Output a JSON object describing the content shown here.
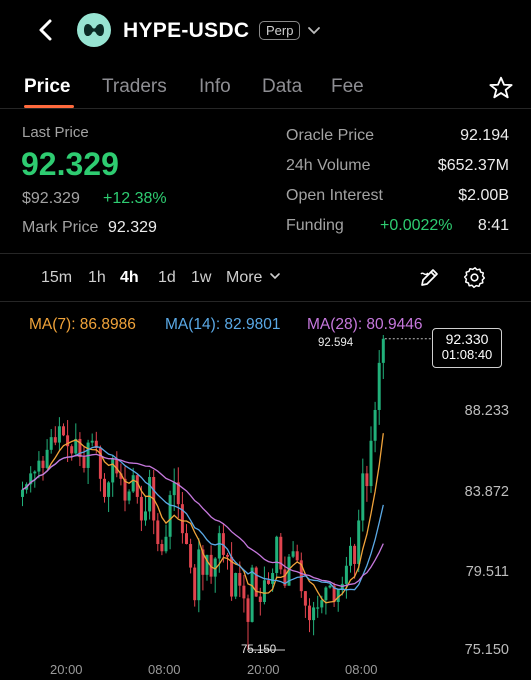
{
  "header": {
    "back_icon": "chevron-left-icon",
    "logo_icon": "hyperliquid-logo-icon",
    "title": "HYPE-USDC",
    "badge": "Perp",
    "dropdown_icon": "chevron-down-icon"
  },
  "tabs": [
    "Price",
    "Traders",
    "Info",
    "Data",
    "Fee"
  ],
  "active_tab": "Price",
  "favorite_icon": "star-icon",
  "stats": {
    "last_price_label": "Last Price",
    "last_price": "92.329",
    "usd_price": "$92.329",
    "change": "+12.38%",
    "mark_label": "Mark Price",
    "mark_price": "92.329",
    "oracle_label": "Oracle Price",
    "oracle_value": "92.194",
    "volume_label": "24h Volume",
    "volume_value": "$652.37M",
    "oi_label": "Open Interest",
    "oi_value": "$2.00B",
    "funding_label": "Funding",
    "funding_rate": "+0.0022%",
    "funding_countdown": "8:41"
  },
  "timeframes": [
    "15m",
    "1h",
    "4h",
    "1d",
    "1w"
  ],
  "active_timeframe": "4h",
  "more_label": "More",
  "toolbar_icons": [
    "draw-pencil-icon",
    "settings-gear-icon"
  ],
  "ma_legend": [
    {
      "label": "MA(7): 86.8986",
      "color": "#f0a33a"
    },
    {
      "label": "MA(14): 82.9801",
      "color": "#5aa9e6"
    },
    {
      "label": "MA(28): 80.9446",
      "color": "#c678dd"
    }
  ],
  "colors": {
    "up": "#21b07a",
    "down": "#e0444e",
    "accent": "#2ecc71",
    "bg": "#000000"
  },
  "chart_data": {
    "type": "candlestick",
    "y_ticks": [
      "88.233",
      "83.872",
      "79.511",
      "75.150"
    ],
    "x_ticks": [
      "20:00",
      "08:00",
      "20:00",
      "08:00"
    ],
    "ylim": [
      75.15,
      92.6
    ],
    "current_price_tag": "92.330",
    "countdown_tag": "01:08:40",
    "high_label": "92.594",
    "low_label": "75.150",
    "ma_values": {
      "ma7": 86.8986,
      "ma14": 82.9801,
      "ma28": 80.9446
    },
    "closes": [
      84.0,
      84.3,
      84.9,
      85.0,
      85.6,
      85.2,
      86.2,
      86.9,
      86.6,
      87.5,
      87.0,
      86.4,
      86.0,
      86.8,
      85.8,
      85.2,
      86.6,
      86.7,
      86.3,
      84.6,
      83.6,
      84.4,
      85.7,
      84.9,
      84.6,
      83.4,
      83.9,
      84.8,
      83.6,
      82.3,
      82.8,
      84.7,
      82.3,
      81.0,
      80.6,
      81.4,
      83.7,
      84.4,
      83.2,
      81.6,
      81.0,
      79.7,
      77.9,
      80.7,
      79.3,
      80.4,
      79.2,
      80.2,
      81.6,
      80.4,
      80.3,
      78.1,
      79.4,
      78.7,
      78.0,
      76.7,
      79.7,
      78.1,
      77.8,
      79.0,
      78.8,
      79.4,
      81.4,
      79.6,
      78.7,
      80.3,
      80.6,
      80.1,
      78.4,
      77.6,
      76.8,
      77.5,
      77.5,
      77.9,
      78.6,
      78.7,
      77.8,
      78.5,
      78.8,
      79.8,
      80.9,
      79.9,
      82.3,
      84.9,
      84.2,
      86.7,
      88.4,
      91.0,
      92.33
    ],
    "ohlc_note": "candles reconstructed from visible chart; open = previous close"
  }
}
